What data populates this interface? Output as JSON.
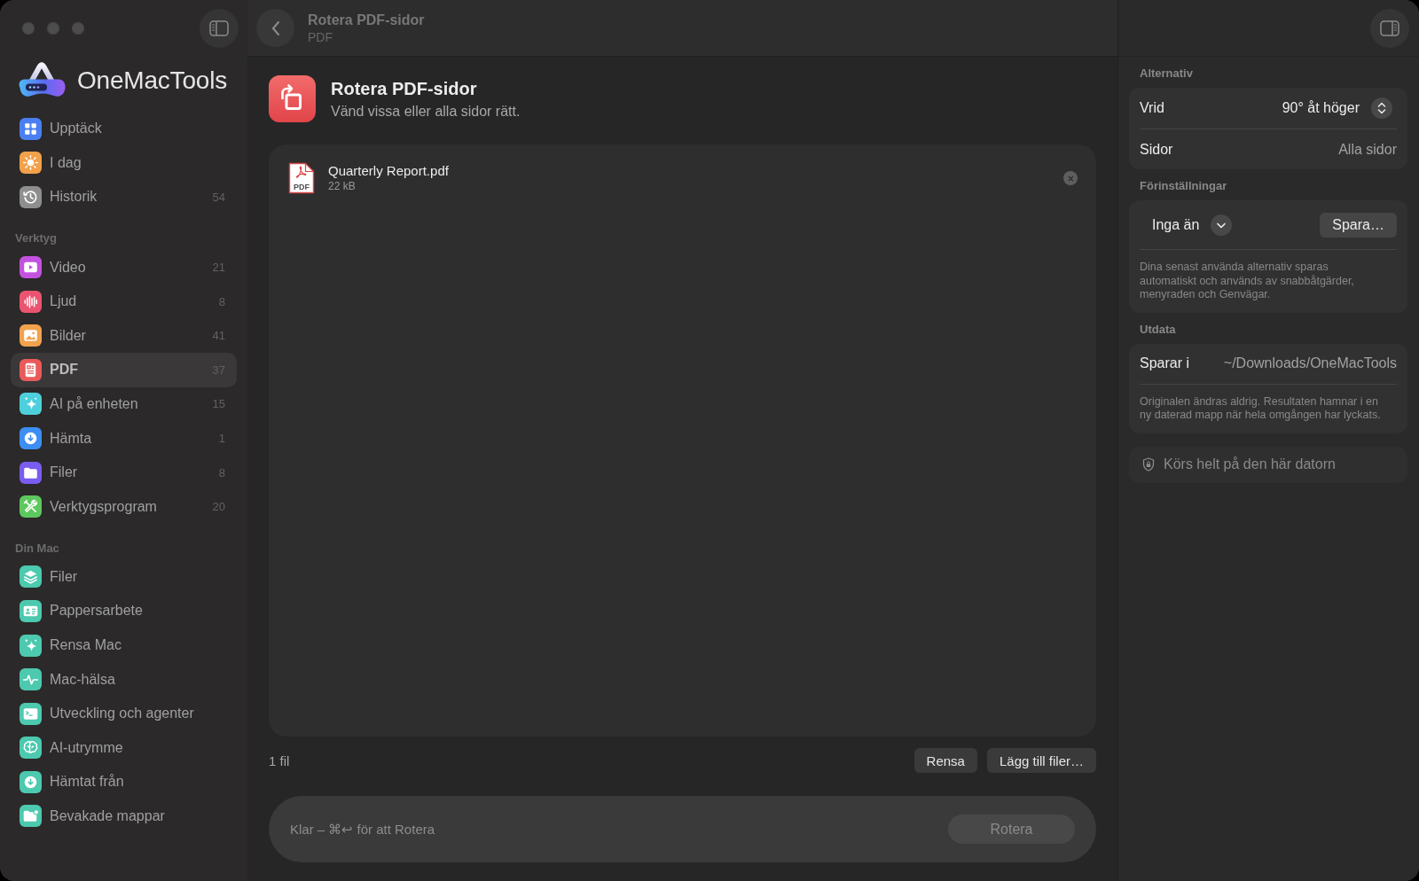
{
  "sidebar": {
    "logo": "OneMacTools",
    "sections": [
      {
        "items": [
          {
            "label": "Upptäck",
            "color": "#4a7ff2",
            "selected": false
          },
          {
            "label": "I dag",
            "color": "#f2a14a",
            "selected": false
          },
          {
            "label": "Historik",
            "count": "54",
            "color": "#8e8e8e",
            "selected": false
          }
        ]
      },
      {
        "title": "Verktyg",
        "items": [
          {
            "label": "Video",
            "count": "21",
            "color": "#c452e0",
            "selected": false
          },
          {
            "label": "Ljud",
            "count": "8",
            "color": "#ea5470",
            "selected": false
          },
          {
            "label": "Bilder",
            "count": "41",
            "color": "#f2a24e",
            "selected": false
          },
          {
            "label": "PDF",
            "count": "37",
            "color": "#ea5a5a",
            "selected": true
          },
          {
            "label": "AI på enheten",
            "count": "15",
            "color": "#4ed0dc",
            "selected": false
          },
          {
            "label": "Hämta",
            "count": "1",
            "color": "#3c8ef2",
            "selected": false
          },
          {
            "label": "Filer",
            "count": "8",
            "color": "#7a5cf0",
            "selected": false
          },
          {
            "label": "Verktygsprogram",
            "count": "20",
            "color": "#5cc85e",
            "selected": false
          }
        ]
      },
      {
        "title": "Din Mac",
        "items": [
          {
            "label": "Filer",
            "color": "#4cc9ae",
            "selected": false
          },
          {
            "label": "Pappersarbete",
            "color": "#4cc9ae",
            "selected": false
          },
          {
            "label": "Rensa Mac",
            "color": "#4cc9ae",
            "selected": false
          },
          {
            "label": "Mac-hälsa",
            "color": "#4cc9ae",
            "selected": false
          },
          {
            "label": "Utveckling och agenter",
            "color": "#4cc9ae",
            "selected": false
          },
          {
            "label": "AI-utrymme",
            "color": "#4cc9ae",
            "selected": false
          },
          {
            "label": "Hämtat från",
            "color": "#4cc9ae",
            "selected": false
          },
          {
            "label": "Bevakade mappar",
            "color": "#4cc9ae",
            "selected": false
          }
        ]
      }
    ]
  },
  "header": {
    "title": "Rotera PDF-sidor",
    "subtitle": "PDF"
  },
  "tool": {
    "title": "Rotera PDF-sidor",
    "description": "Vänd vissa eller alla sidor rätt."
  },
  "files": [
    {
      "name": "Quarterly Report.pdf",
      "size": "22 kB",
      "type_label": "PDF"
    }
  ],
  "footer": {
    "file_count": "1 fil",
    "buttons": [
      "Rensa",
      "Lägg till filer…"
    ]
  },
  "action_bar": {
    "status": "Klar – ⌘↩ för att Rotera",
    "button": {
      "label": "Rotera",
      "disabled": true
    }
  },
  "inspector": {
    "sections": [
      {
        "title": "Alternativ",
        "rows": [
          {
            "kind": "popup",
            "label": "Vrid",
            "value": "90° åt höger"
          },
          {
            "kind": "value",
            "label": "Sidor",
            "value": "Alla sidor"
          }
        ]
      },
      {
        "title": "Förinställningar",
        "rows": [
          {
            "kind": "preset",
            "value": "Inga än",
            "button": "Spara…"
          }
        ],
        "note": "Dina senast använda alternativ sparas automatiskt och används av snabbåtgärder, menyraden och Genvägar."
      },
      {
        "title": "Utdata",
        "rows": [
          {
            "kind": "value",
            "label": "Sparar i",
            "value": "~/Downloads/OneMacTools"
          }
        ],
        "note": "Originalen ändras aldrig. Resultaten hamnar i en ny daterad mapp när hela omgången har lyckats."
      }
    ],
    "privacy_note": "Körs helt på den här datorn"
  }
}
